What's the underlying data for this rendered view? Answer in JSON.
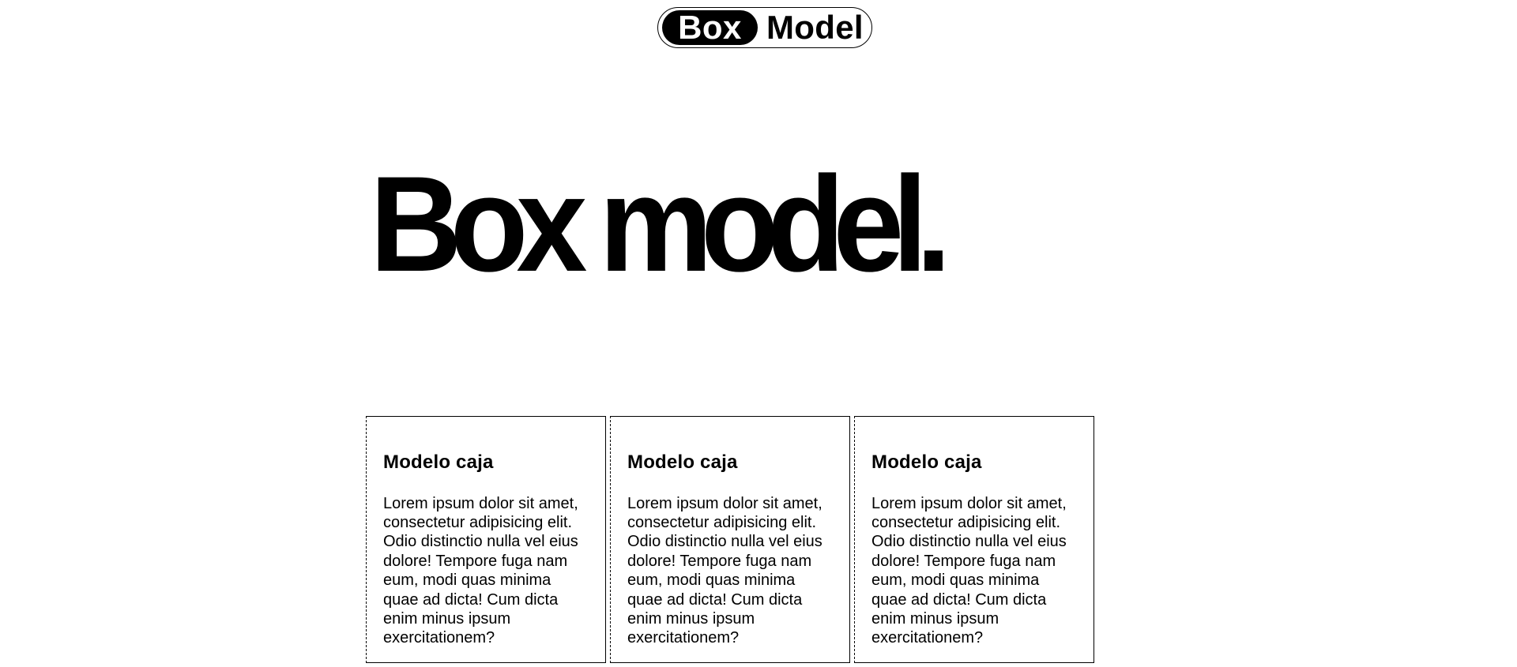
{
  "header": {
    "logo_box": "Box",
    "logo_model": "Model"
  },
  "hero": {
    "title": "Box model."
  },
  "cards": [
    {
      "title": "Modelo caja",
      "body": "Lorem ipsum dolor sit amet, consectetur adipisicing elit. Odio distinctio nulla vel eius dolore! Tempore fuga nam eum, modi quas minima quae ad dicta! Cum dicta enim minus ipsum exercitationem?"
    },
    {
      "title": "Modelo caja",
      "body": "Lorem ipsum dolor sit amet, consectetur adipisicing elit. Odio distinctio nulla vel eius dolore! Tempore fuga nam eum, modi quas minima quae ad dicta! Cum dicta enim minus ipsum exercitationem?"
    },
    {
      "title": "Modelo caja",
      "body": "Lorem ipsum dolor sit amet, consectetur adipisicing elit. Odio distinctio nulla vel eius dolore! Tempore fuga nam eum, modi quas minima quae ad dicta! Cum dicta enim minus ipsum exercitationem?"
    }
  ],
  "colors": {
    "background": "#ffffff",
    "foreground": "#000000"
  }
}
